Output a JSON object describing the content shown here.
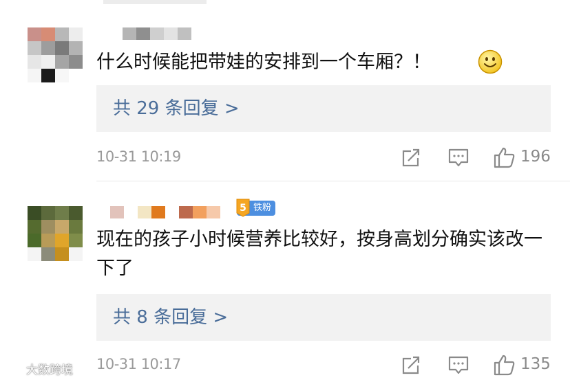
{
  "comments": [
    {
      "text": "什么时候能把带娃的安排到一个车厢？！",
      "emoji_name": "smile-emoji",
      "reply_link": "共 29 条回复 >",
      "timestamp": "10-31 10:19",
      "like_count": "196"
    },
    {
      "text": "现在的孩子小时候营养比较好，按身高划分确实该改一下了",
      "fan_badge": "铁粉",
      "fan_level": "5",
      "reply_link": "共 8 条回复 >",
      "timestamp": "10-31 10:17",
      "like_count": "135"
    }
  ],
  "icons": {
    "share": "share-icon",
    "comment": "comment-icon",
    "like": "thumbs-up-icon"
  },
  "watermark": {
    "text": "大数跨境"
  },
  "colors": {
    "link": "#4a6d99",
    "text": "#111111",
    "meta": "#9a9a9a",
    "reply_bg": "#f2f2f2",
    "badge": "#4d8fe0"
  }
}
